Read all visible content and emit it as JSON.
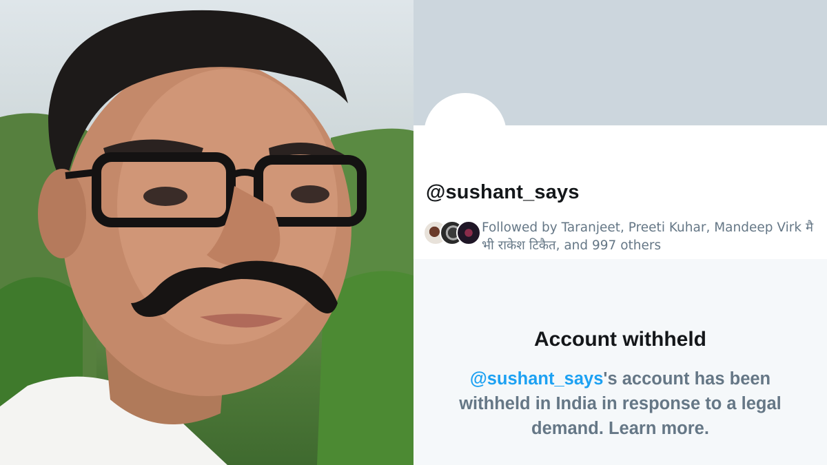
{
  "profile": {
    "handle": "@sushant_says",
    "followed_by": "Followed by Taranjeet, Preeti Kuhar, Mandeep Virk मै भी राकेश टिकैत, and 997 others"
  },
  "withheld": {
    "title": "Account withheld",
    "handle_link": "@sushant_says",
    "message": "'s account has been withheld in India in response to a legal demand. ",
    "learn_more": "Learn more."
  },
  "colors": {
    "banner": "#ccd6dd",
    "link": "#1da1f2",
    "muted_text": "#657786",
    "primary_text": "#14171a"
  }
}
